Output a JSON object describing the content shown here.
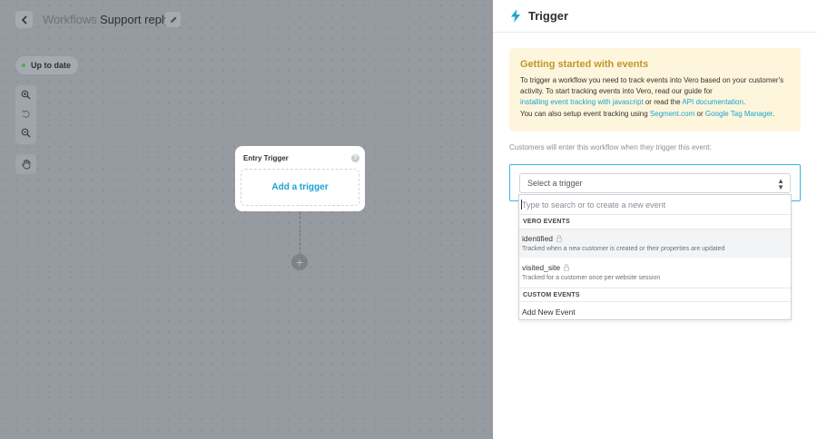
{
  "breadcrumb": {
    "root": "Workflows",
    "separator": "›",
    "title": "Support reply"
  },
  "status": {
    "label": "Up to date",
    "color": "#4caf50"
  },
  "canvas_tools": [
    {
      "icon": "zoom-in-icon"
    },
    {
      "icon": "undo-icon"
    },
    {
      "icon": "zoom-out-icon"
    },
    {
      "icon": "hand-icon"
    }
  ],
  "node": {
    "title": "Entry Trigger",
    "help": "?",
    "add_label": "Add a trigger",
    "plus": "+"
  },
  "panel": {
    "title": "Trigger",
    "info": {
      "title": "Getting started with events",
      "text_1": "To trigger a workflow you need to track events into Vero based on your customer's activity. To start tracking events into Vero, read our guide for",
      "link_1": "installing event tracking with javascript",
      "text_2": "or read the",
      "link_2": "API documentation",
      "text_3": ".",
      "line2_text_1": "You can also setup event tracking using",
      "line2_link_1": "Segment.com",
      "line2_text_2": "or",
      "line2_link_2": "Google Tag Manager",
      "line2_text_3": "."
    },
    "prompt": "Customers will enter this workflow when they trigger this event:",
    "select": {
      "label": "Select a trigger"
    },
    "dropdown": {
      "search_placeholder": "Type to search or to create a new event",
      "group_vero": "VERO EVENTS",
      "items": [
        {
          "name": "identified",
          "desc": "Tracked when a new customer is created or their properties are updated"
        },
        {
          "name": "visited_site",
          "desc": "Tracked for a customer once per website session"
        }
      ],
      "group_custom": "CUSTOM EVENTS",
      "add_new": "Add New Event"
    }
  },
  "colors": {
    "accent": "#1aa3d1",
    "info_title": "#c0962a",
    "info_bg": "#fdf6dc"
  }
}
